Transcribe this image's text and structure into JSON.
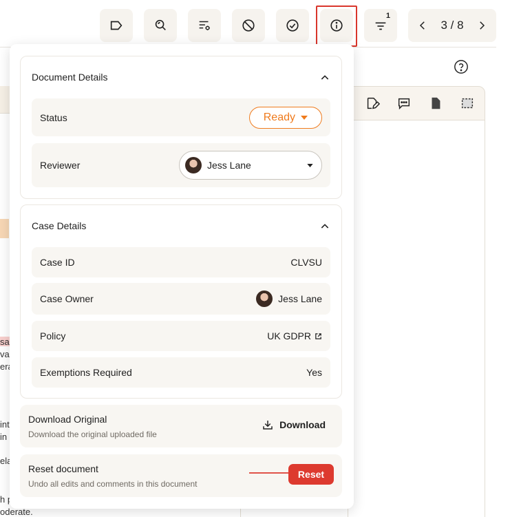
{
  "toolbar": {
    "filter_badge": "1",
    "pager": "3 / 8"
  },
  "icons": [
    "tag-icon",
    "search-zoom-icon",
    "settings-list-icon",
    "block-icon",
    "check-circle-icon",
    "info-icon",
    "filter-icon",
    "chevron-left-icon",
    "chevron-right-icon",
    "help-icon",
    "edit-icon",
    "comment-icon",
    "file-icon",
    "select-area-icon"
  ],
  "colors": {
    "accent_orange": "#ef7b1d",
    "danger_red": "#dd3a2f",
    "highlight_red": "#d9352b"
  },
  "document_details": {
    "title": "Document Details",
    "status_label": "Status",
    "status_value": "Ready",
    "reviewer_label": "Reviewer",
    "reviewer_value": "Jess Lane"
  },
  "case_details": {
    "title": "Case Details",
    "rows": [
      {
        "label": "Case ID",
        "value": "CLVSU"
      },
      {
        "label": "Case Owner",
        "value": "Jess Lane"
      },
      {
        "label": "Policy",
        "value": "UK GDPR"
      },
      {
        "label": "Exemptions Required",
        "value": "Yes"
      }
    ]
  },
  "download": {
    "title": "Download Original",
    "subtitle": "Download the original uploaded file",
    "button": "Download"
  },
  "reset": {
    "title": "Reset document",
    "subtitle": "Undo all edits and comments in this document",
    "button": "Reset"
  },
  "background_fragments": [
    "sa",
    "va",
    "era",
    "int",
    "in",
    "ela",
    "h p",
    "oderate."
  ]
}
